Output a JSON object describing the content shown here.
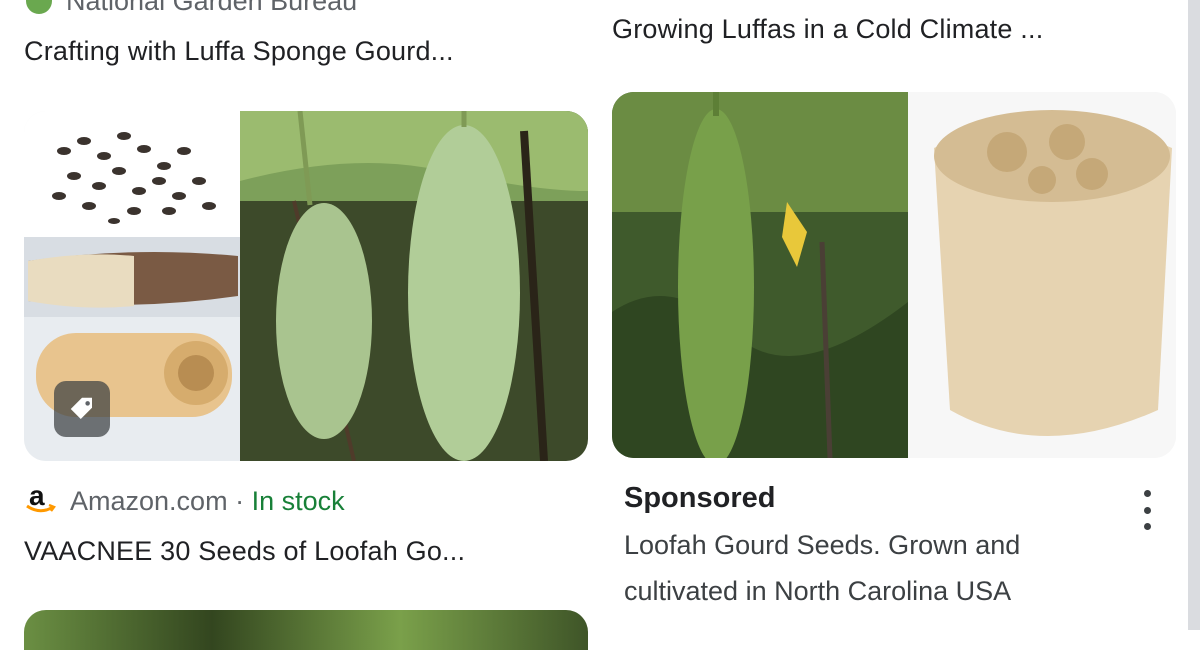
{
  "top_left_card": {
    "source": "National Garden Bureau",
    "title": "Crafting with Luffa Sponge Gourd..."
  },
  "top_right_card": {
    "title": "Growing Luffas in a Cold Climate ..."
  },
  "amazon_card": {
    "source_logo": "a",
    "source": "Amazon.com",
    "separator": " · ",
    "availability": "In stock",
    "title": "VAACNEE 30 Seeds of Loofah Go...",
    "tag_icon": "tag-icon"
  },
  "sponsored_card": {
    "label": "Sponsored",
    "description_line1": "Loofah Gourd Seeds. Grown and",
    "description_line2": "cultivated in North Carolina USA",
    "menu_icon": "more-vert-icon"
  },
  "colors": {
    "in_stock": "#188038",
    "source_text": "#5f6368",
    "title_text": "#202124",
    "amazon_orange": "#ff9900"
  }
}
